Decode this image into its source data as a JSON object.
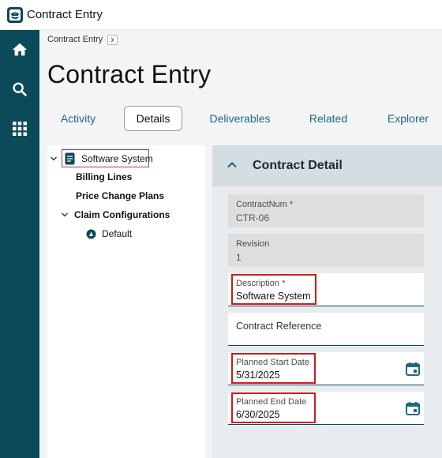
{
  "window": {
    "title": "Contract Entry"
  },
  "nav": {
    "icons": [
      "home-icon",
      "search-icon",
      "apps-grid-icon"
    ]
  },
  "breadcrumb": {
    "label": "Contract Entry"
  },
  "page": {
    "title": "Contract Entry"
  },
  "tabs": [
    {
      "label": "Activity"
    },
    {
      "label": "Details",
      "active": true
    },
    {
      "label": "Deliverables"
    },
    {
      "label": "Related"
    },
    {
      "label": "Explorer"
    }
  ],
  "tree": {
    "root": {
      "label": "Software System"
    },
    "items": [
      {
        "label": "Billing Lines"
      },
      {
        "label": "Price Change Plans"
      },
      {
        "label": "Claim Configurations"
      }
    ],
    "child": {
      "label": "Default"
    }
  },
  "detail": {
    "title": "Contract Detail",
    "fields": {
      "contract_num": {
        "label": "ContractNum *",
        "value": "CTR-06"
      },
      "revision": {
        "label": "Revision",
        "value": "1"
      },
      "description": {
        "label": "Description *",
        "value": "Software System"
      },
      "contract_reference": {
        "label": "Contract Reference",
        "value": ""
      },
      "planned_start": {
        "label": "Planned Start Date",
        "value": "5/31/2025"
      },
      "planned_end": {
        "label": "Planned End Date",
        "value": "6/30/2025"
      }
    }
  },
  "colors": {
    "brand": "#0c4a5a",
    "accent_link": "#1e6a80",
    "highlight_red": "#d11a1a",
    "selection": "#b0306e"
  }
}
